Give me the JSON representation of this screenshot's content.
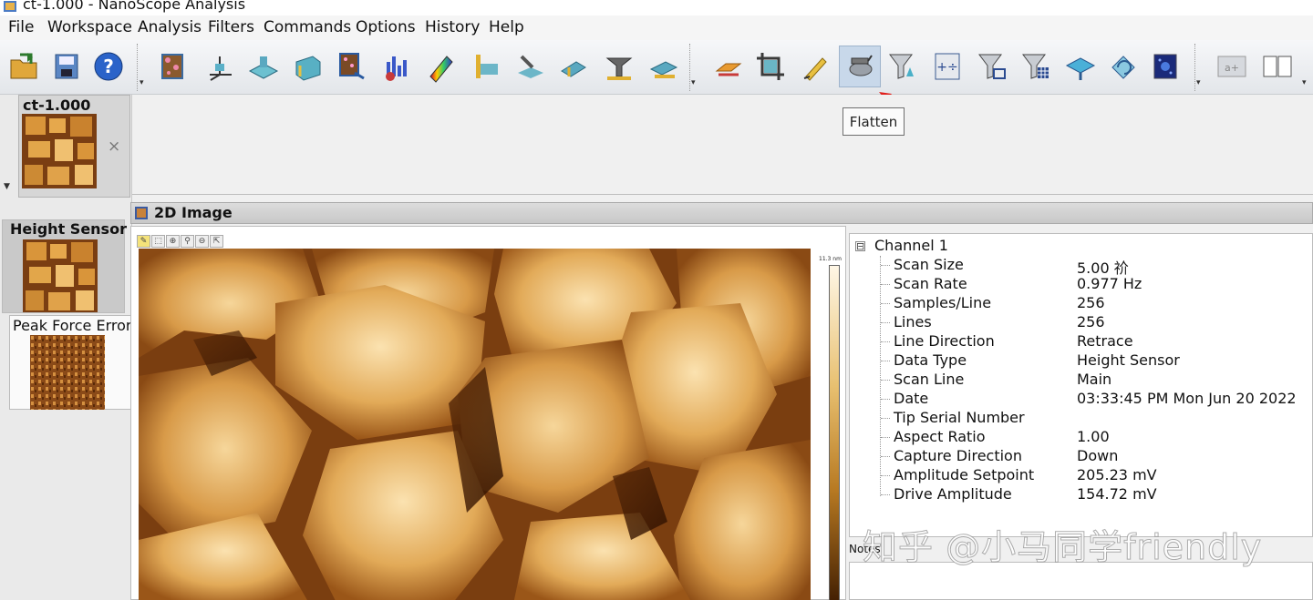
{
  "window": {
    "title": "ct-1.000 - NanoScope Analysis"
  },
  "menu": [
    {
      "label": "File"
    },
    {
      "label": "Workspace"
    },
    {
      "label": "Analysis"
    },
    {
      "label": "Filters"
    },
    {
      "label": "Commands"
    },
    {
      "label": "Options"
    },
    {
      "label": "History"
    },
    {
      "label": "Help"
    }
  ],
  "toolbar": {
    "icons": [
      "open-folder-icon",
      "save-icon",
      "help-icon",
      "image-3d-icon",
      "axes-icon",
      "surface-icon",
      "section-icon",
      "particle-icon",
      "bearing-icon",
      "spectrum-icon",
      "ruler-icon",
      "roughness-icon",
      "tip-icon",
      "depth-icon",
      "step-icon",
      "step-height-icon",
      "erase-icon",
      "crop-icon",
      "highlight-icon",
      "flatten-icon",
      "filter-icon",
      "calculator-icon",
      "lowpass-icon",
      "median-icon",
      "plane-fit-icon",
      "rotate-icon",
      "fft-icon",
      "text-icon",
      "book-icon"
    ],
    "active_tool": "Flatten"
  },
  "tooltip": {
    "text": "Flatten"
  },
  "workspace": {
    "file_tab": "ct-1.000",
    "close_glyph": "×"
  },
  "channels": [
    {
      "label": "Height Sensor",
      "selected": true
    },
    {
      "label": "Peak Force Error",
      "selected": false
    }
  ],
  "view": {
    "title": "2D Image",
    "colorbar_max": "11.3 nm"
  },
  "properties": {
    "root": "Channel 1",
    "expander": "⊟",
    "rows": [
      {
        "name": "Scan Size",
        "value": "5.00 祄"
      },
      {
        "name": "Scan Rate",
        "value": "0.977 Hz"
      },
      {
        "name": "Samples/Line",
        "value": "256"
      },
      {
        "name": "Lines",
        "value": "256"
      },
      {
        "name": "Line Direction",
        "value": "Retrace"
      },
      {
        "name": "Data Type",
        "value": "Height Sensor"
      },
      {
        "name": "Scan Line",
        "value": "Main"
      },
      {
        "name": "Date",
        "value": "03:33:45 PM Mon Jun 20 2022"
      },
      {
        "name": "Tip Serial Number",
        "value": ""
      },
      {
        "name": "Aspect Ratio",
        "value": "1.00"
      },
      {
        "name": "Capture Direction",
        "value": "Down"
      },
      {
        "name": "Amplitude Setpoint",
        "value": "205.23 mV"
      },
      {
        "name": "Drive Amplitude",
        "value": "154.72 mV"
      }
    ]
  },
  "notes": {
    "label": "Notes"
  },
  "watermark": "知乎 @小马同学friendly",
  "colors": {
    "accent_arrow": "#e0201c",
    "active_tool_bg": "#c8d8ea"
  }
}
